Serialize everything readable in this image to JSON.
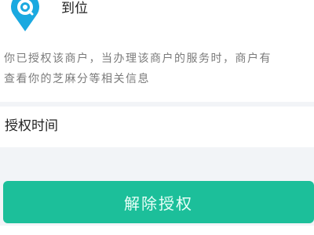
{
  "merchant": {
    "icon": "location-pin-icon",
    "name": "到位"
  },
  "description": {
    "line1": "你已授权该商户，当办理该商户的服务时，商户有",
    "line2": "查看你的芝麻分等相关信息"
  },
  "auth_time": {
    "label": "授权时间",
    "value": ""
  },
  "revoke_button": {
    "label": "解除授权"
  },
  "colors": {
    "accent": "#1cbf9a",
    "icon": "#1aa9e0",
    "background": "#f2f4f7"
  }
}
